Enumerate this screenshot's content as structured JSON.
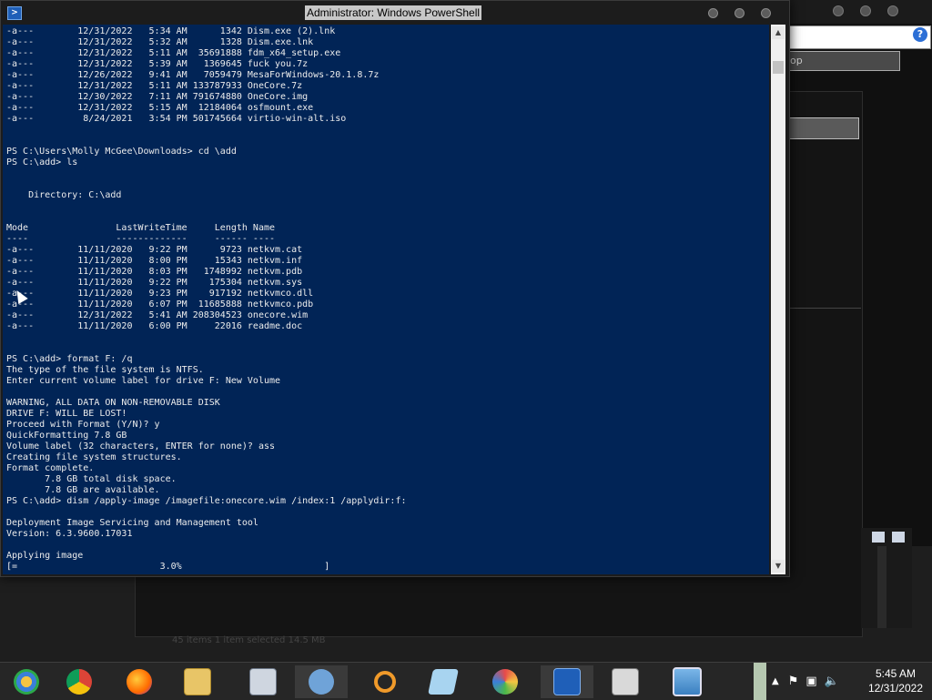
{
  "window": {
    "title": "Administrator: Windows PowerShell",
    "console_lines": [
      "-a---        12/31/2022   5:34 AM      1342 Dism.exe (2).lnk",
      "-a---        12/31/2022   5:32 AM      1328 Dism.exe.lnk",
      "-a---        12/31/2022   5:11 AM  35691888 fdm_x64_setup.exe",
      "-a---        12/31/2022   5:39 AM   1369645 fuck you.7z",
      "-a---        12/26/2022   9:41 AM   7059479 MesaForWindows-20.1.8.7z",
      "-a---        12/31/2022   5:11 AM 133787933 OneCore.7z",
      "-a---        12/30/2022   7:11 AM 791674880 OneCore.img",
      "-a---        12/31/2022   5:15 AM  12184064 osfmount.exe",
      "-a---         8/24/2021   3:54 PM 501745664 virtio-win-alt.iso",
      "",
      "",
      "PS C:\\Users\\Molly McGee\\Downloads> cd \\add",
      "PS C:\\add> ls",
      "",
      "",
      "    Directory: C:\\add",
      "",
      "",
      "Mode                LastWriteTime     Length Name",
      "----                -------------     ------ ----",
      "-a---        11/11/2020   9:22 PM      9723 netkvm.cat",
      "-a---        11/11/2020   8:00 PM     15343 netkvm.inf",
      "-a---        11/11/2020   8:03 PM   1748992 netkvm.pdb",
      "-a---        11/11/2020   9:22 PM    175304 netkvm.sys",
      "-a---        11/11/2020   9:23 PM    917192 netkvmco.dll",
      "-a---        11/11/2020   6:07 PM  11685888 netkvmco.pdb",
      "-a---        12/31/2022   5:41 AM 208304523 onecore.wim",
      "-a---        11/11/2020   6:00 PM     22016 readme.doc",
      "",
      "",
      "PS C:\\add> format F: /q",
      "The type of the file system is NTFS.",
      "Enter current volume label for drive F: New Volume",
      "",
      "WARNING, ALL DATA ON NON-REMOVABLE DISK",
      "DRIVE F: WILL BE LOST!",
      "Proceed with Format (Y/N)? y",
      "QuickFormatting 7.8 GB",
      "Volume label (32 characters, ENTER for none)? ass",
      "Creating file system structures.",
      "Format complete.",
      "       7.8 GB total disk space.",
      "       7.8 GB are available.",
      "PS C:\\add> dism /apply-image /imagefile:onecore.wim /index:1 /applydir:f:",
      "",
      "Deployment Image Servicing and Management tool",
      "Version: 6.3.9600.17031",
      "",
      "Applying image",
      "[=                          3.0%                          ]"
    ]
  },
  "background": {
    "search_placeholder": "op",
    "status_text": "45 items   1 item selected  14.5 MB"
  },
  "taskbar": {
    "items": [
      "start-icon",
      "chrome-icon",
      "firefox-icon",
      "file-explorer-icon",
      "keyboard-icon",
      "users-icon",
      "search-icon",
      "notepad-icon",
      "paint-icon",
      "powershell-icon",
      "archive-icon",
      "picture-viewer-icon"
    ],
    "clock_time": "5:45 AM",
    "clock_date": "12/31/2022"
  }
}
